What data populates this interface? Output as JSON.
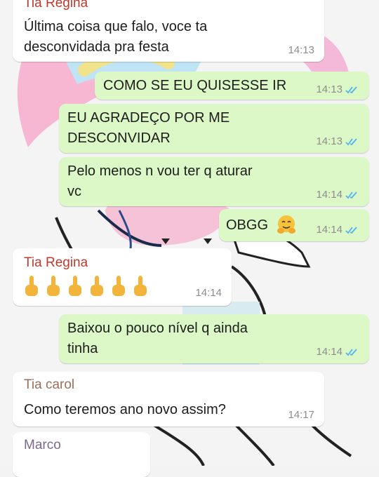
{
  "messages": [
    {
      "sender": "Tia Regina",
      "text": "Última coisa que falo, voce ta\ndesconvidada pra festa",
      "time": "14:13"
    },
    {
      "text": "COMO SE EU QUISESSE IR",
      "time": "14:13"
    },
    {
      "text": "EU AGRADEÇO POR ME\nDESCONVIDAR",
      "time": "14:13"
    },
    {
      "text": "Pelo menos n vou ter q aturar\nvc",
      "time": "14:14"
    },
    {
      "text": "OBGG",
      "time": "14:14",
      "emoji": "hugging-face-emoji"
    },
    {
      "sender": "Tia Regina",
      "emoji": "middle-finger-emoji",
      "emoji_count": 6,
      "time": "14:14"
    },
    {
      "text": "Baixou o pouco nível q ainda\ntinha",
      "time": "14:14"
    },
    {
      "sender": "Tia carol",
      "text": "Como teremos ano novo assim?",
      "time": "14:17"
    },
    {
      "sender": "Marco"
    }
  ],
  "colors": {
    "incoming_bg": "#ffffff",
    "outgoing_bg": "#dcf8c6",
    "read_ticks": "#4fb3ef",
    "tia_regina_name": "#c0392b",
    "tia_carol_name": "#9a6f5a",
    "marco_name": "#7a6a8a"
  }
}
